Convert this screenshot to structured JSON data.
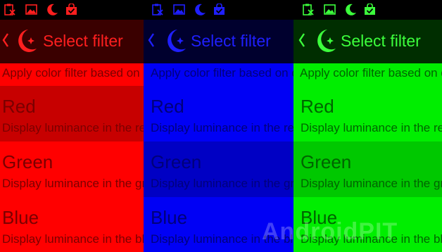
{
  "panels": [
    {
      "name": "red",
      "fg": "#7a0000",
      "actionbar_bg": "#3a0000",
      "actionbar_fg": "#ff1f1f",
      "status_fg": "#ff1f1f",
      "bg": "#ff0000",
      "selected_bg": "#c70000",
      "selected_index": 0
    },
    {
      "name": "blue",
      "fg": "#00007a",
      "actionbar_bg": "#00002e",
      "actionbar_fg": "#1f1fff",
      "status_fg": "#1f1fff",
      "bg": "#0000f5",
      "selected_bg": "#0000c4",
      "selected_index": 1
    },
    {
      "name": "green",
      "fg": "#006400",
      "actionbar_bg": "#002e00",
      "actionbar_fg": "#3cff3c",
      "status_fg": "#3cff3c",
      "bg": "#00ee00",
      "selected_bg": "#00c800",
      "selected_index": 1
    }
  ],
  "status_icons": [
    "clipboard-x-icon",
    "image-icon",
    "moon-icon",
    "bag-check-icon"
  ],
  "screen": {
    "title": "Select filter",
    "description": "Apply color filter based on display luminance",
    "options": [
      {
        "label": "Red",
        "sub": "Display luminance in the red channel"
      },
      {
        "label": "Green",
        "sub": "Display luminance in the green channel"
      },
      {
        "label": "Blue",
        "sub": "Display luminance in the blue channel"
      }
    ]
  },
  "watermark": "AndroidPIT"
}
